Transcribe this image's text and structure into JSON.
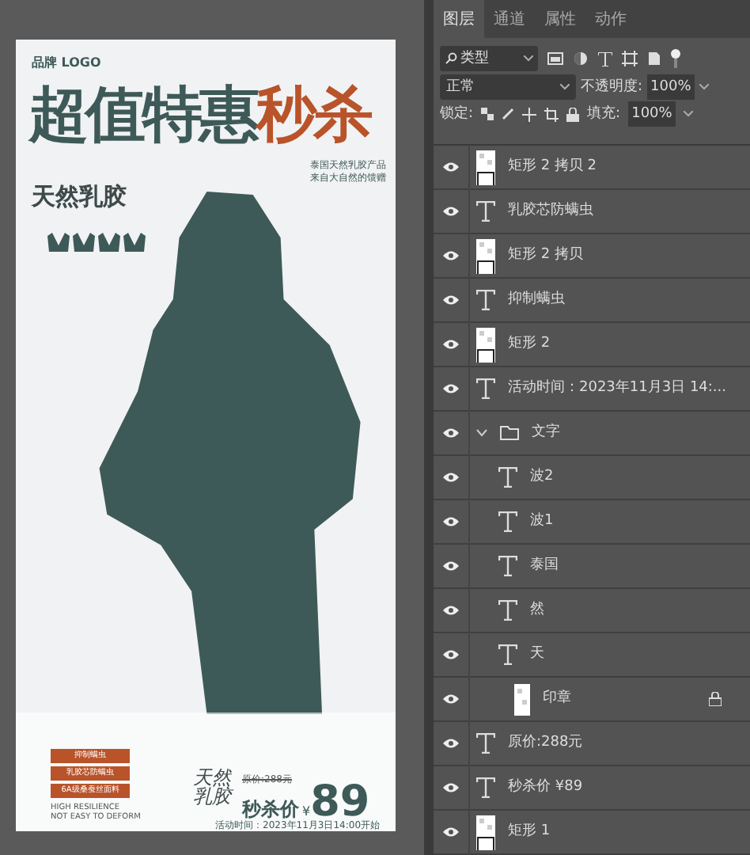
{
  "poster": {
    "brand": "品牌 LOGO",
    "headline_dark": "超值特惠",
    "headline_accent": "秒杀",
    "badge": "天然乳胶",
    "side_note": [
      "泰国天然乳胶产品",
      "来自大自然的馈赠"
    ],
    "tags": [
      "抑制螨虫",
      "乳胶芯防螨虫",
      "6A级桑蚕丝面料"
    ],
    "tag_note": [
      "HIGH RESILIENCE",
      "NOT EASY TO DEFORM"
    ],
    "logo_text": [
      "天然",
      "乳胶"
    ],
    "original_price": "原价:288元",
    "sale_label": "秒杀价",
    "currency": "¥",
    "price": "89",
    "time": "活动时间：2023年11月3日14:00开始"
  },
  "panel": {
    "tabs": [
      {
        "label": "图层",
        "selected": true
      },
      {
        "label": "通道",
        "selected": false
      },
      {
        "label": "属性",
        "selected": false
      },
      {
        "label": "动作",
        "selected": false
      }
    ],
    "filter": "类型",
    "blend_mode": "正常",
    "opacity_label": "不透明度:",
    "opacity": "100%",
    "lock_label": "锁定:",
    "fill_label": "填充:",
    "fill": "100%",
    "layers": [
      {
        "kind": "shape",
        "name": "矩形 2 拷贝 2",
        "visible": true,
        "locked": false
      },
      {
        "kind": "text",
        "name": "乳胶芯防螨虫",
        "visible": true,
        "locked": false
      },
      {
        "kind": "shape",
        "name": "矩形 2 拷贝",
        "visible": true,
        "locked": false
      },
      {
        "kind": "text",
        "name": "抑制螨虫",
        "visible": true,
        "locked": false
      },
      {
        "kind": "shape",
        "name": "矩形 2",
        "visible": true,
        "locked": false
      },
      {
        "kind": "text",
        "name": "活动时间：2023年11月3日 14:...",
        "visible": true,
        "locked": false
      },
      {
        "kind": "group",
        "name": "文字",
        "visible": true,
        "locked": false,
        "expanded": true,
        "children": [
          {
            "kind": "text",
            "name": "波2",
            "visible": true,
            "locked": false
          },
          {
            "kind": "text",
            "name": "波1",
            "visible": true,
            "locked": false
          },
          {
            "kind": "text",
            "name": "泰国",
            "visible": true,
            "locked": false
          },
          {
            "kind": "text",
            "name": "然",
            "visible": true,
            "locked": false
          },
          {
            "kind": "text",
            "name": "天",
            "visible": true,
            "locked": false
          },
          {
            "kind": "image",
            "name": "印章",
            "visible": true,
            "locked": true
          }
        ]
      },
      {
        "kind": "text",
        "name": "原价:288元",
        "visible": true,
        "locked": false
      },
      {
        "kind": "text",
        "name": "秒杀价 ¥89",
        "visible": true,
        "locked": false
      },
      {
        "kind": "shape",
        "name": "矩形 1",
        "visible": true,
        "locked": false
      }
    ]
  }
}
